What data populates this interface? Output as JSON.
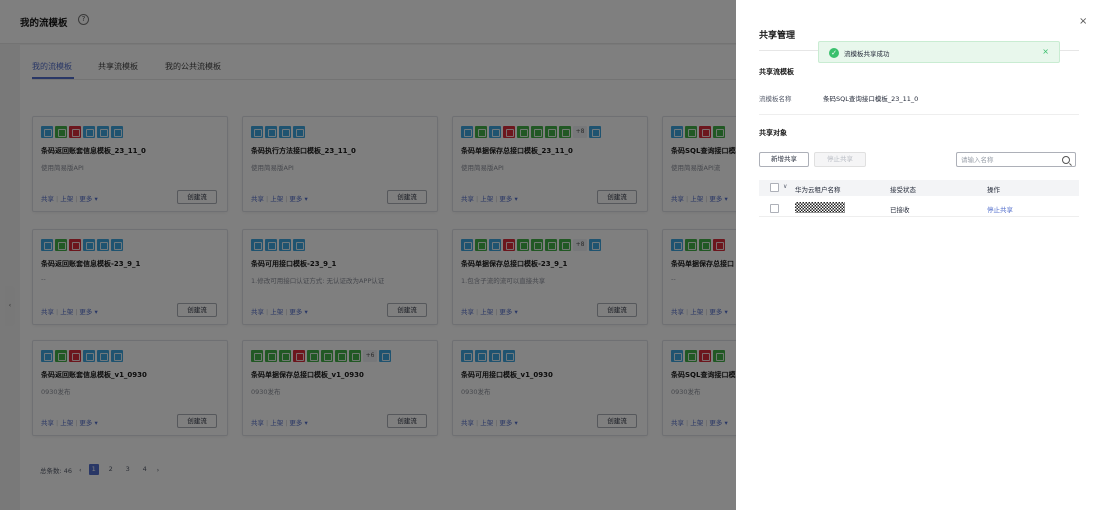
{
  "page": {
    "title": "我的流模板",
    "help_icon": "?",
    "tabs": [
      {
        "label": "我的流模板",
        "active": true
      },
      {
        "label": "共享流模板",
        "active": false
      },
      {
        "label": "我的公共流模板",
        "active": false
      }
    ]
  },
  "cards": [
    {
      "icons": [
        "blue",
        "green",
        "red",
        "blue",
        "blue",
        "blue"
      ],
      "more": "",
      "title": "条码返回账套信息模板_23_11_0",
      "desc": "使用简易版API",
      "button": "创建流"
    },
    {
      "icons": [
        "blue",
        "blue",
        "blue",
        "blue"
      ],
      "more": "",
      "title": "条码执行方法接口模板_23_11_0",
      "desc": "使用简易版API",
      "button": "创建流"
    },
    {
      "icons": [
        "blue",
        "green",
        "blue",
        "red",
        "green",
        "green",
        "green",
        "green"
      ],
      "more": "+8",
      "title": "条码单据保存总接口模板_23_11_0",
      "desc": "使用简易版API",
      "button": "创建流"
    },
    {
      "icons": [
        "blue",
        "green",
        "red",
        "green"
      ],
      "more": "",
      "title": "条码SQL查询接口模板",
      "desc": "使用简易版API流",
      "button": "创建流"
    },
    {
      "icons": [
        "blue",
        "green",
        "red",
        "blue",
        "blue",
        "blue"
      ],
      "more": "",
      "title": "条码返回账套信息模板-23_9_1",
      "desc": "--",
      "button": "创建流"
    },
    {
      "icons": [
        "blue",
        "blue",
        "blue",
        "blue"
      ],
      "more": "",
      "title": "条码可用接口模板-23_9_1",
      "desc": "1.修改可用接口认证方式: 无认证改为APP认证",
      "button": "创建流"
    },
    {
      "icons": [
        "blue",
        "green",
        "blue",
        "red",
        "green",
        "green",
        "green",
        "green"
      ],
      "more": "+8",
      "title": "条码单据保存总接口模板-23_9_1",
      "desc": "1.包含子流的流可以直接共享",
      "button": "创建流"
    },
    {
      "icons": [
        "blue",
        "green",
        "green",
        "red"
      ],
      "more": "",
      "title": "条码单据保存总接口",
      "desc": "--",
      "button": "创建流"
    },
    {
      "icons": [
        "blue",
        "green",
        "red",
        "blue",
        "blue",
        "blue"
      ],
      "more": "",
      "title": "条码返回账套信息模板_v1_0930",
      "desc": "0930发布",
      "button": "创建流"
    },
    {
      "icons": [
        "green",
        "green",
        "green",
        "red",
        "green",
        "green",
        "green",
        "green"
      ],
      "more": "+6",
      "title": "条码单据保存总接口模板_v1_0930",
      "desc": "0930发布",
      "button": "创建流"
    },
    {
      "icons": [
        "blue",
        "blue",
        "blue",
        "blue"
      ],
      "more": "",
      "title": "条码可用接口模板_v1_0930",
      "desc": "0930发布",
      "button": "创建流"
    },
    {
      "icons": [
        "blue",
        "green",
        "red",
        "green"
      ],
      "more": "",
      "title": "条码SQL查询接口模",
      "desc": "0930发布",
      "button": "创建流"
    }
  ],
  "card_actions": {
    "share": "共享",
    "publish": "上架",
    "more": "更多 ▾"
  },
  "pagination": {
    "total_label": "总条数: 46",
    "prev": "‹",
    "next": "›",
    "pages": [
      "1",
      "2",
      "3",
      "4"
    ],
    "current": "1"
  },
  "drawer": {
    "title": "共享管理",
    "close": "×",
    "toast": {
      "text": "流模板共享成功",
      "check": "✓",
      "close": "×"
    },
    "section_template": "共享流模板",
    "template_name_label": "流模板名称",
    "template_name_value": "条码SQL查询接口模板_23_11_0",
    "section_targets": "共享对象",
    "add_button": "新增共享",
    "stop_button": "停止共享",
    "search_placeholder": "请输入名称",
    "table": {
      "headers": [
        "华为云租户名称",
        "接受状态",
        "操作"
      ],
      "rows": [
        {
          "name": "",
          "status": "已接收",
          "action": "停止共享"
        }
      ]
    }
  },
  "colors": {
    "accent": "#526ecc",
    "success": "#3ac06d",
    "icon_blue": "#3ea7e0",
    "icon_green": "#43b149",
    "icon_red": "#d92c3a"
  }
}
